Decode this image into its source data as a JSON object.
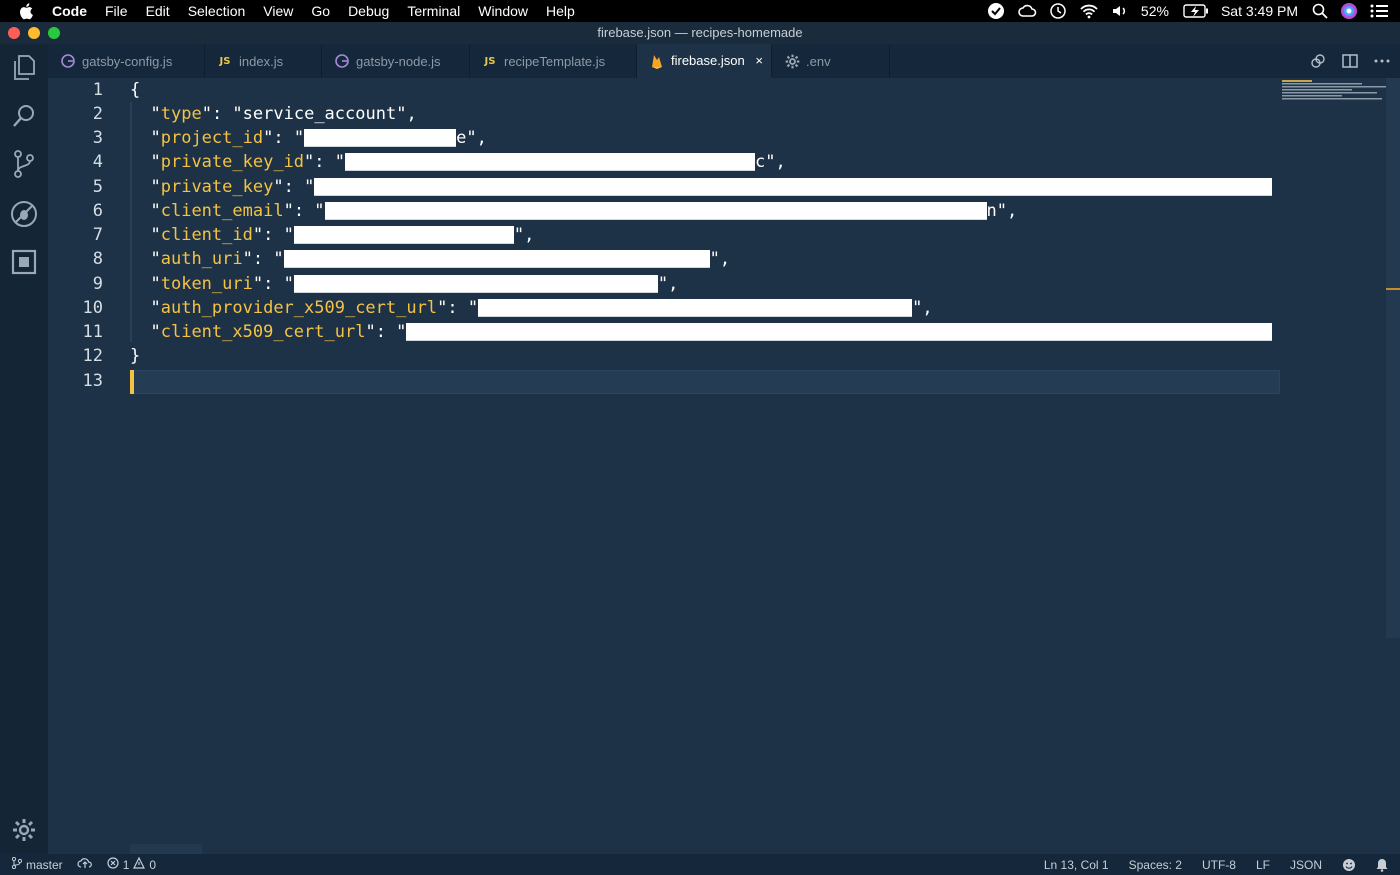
{
  "menubar": {
    "app_name": "Code",
    "items": [
      "File",
      "Edit",
      "Selection",
      "View",
      "Go",
      "Debug",
      "Terminal",
      "Window",
      "Help"
    ],
    "battery": "52%",
    "clock": "Sat 3:49 PM"
  },
  "window": {
    "title": "firebase.json — recipes-homemade"
  },
  "tabs": [
    {
      "label": "gatsby-config.js",
      "icon": "gatsby-icon"
    },
    {
      "label": "index.js",
      "icon": "js-icon",
      "badge": "JS"
    },
    {
      "label": "gatsby-node.js",
      "icon": "gatsby-icon"
    },
    {
      "label": "recipeTemplate.js",
      "icon": "js-icon",
      "badge": "JS"
    },
    {
      "label": "firebase.json",
      "icon": "firebase-icon",
      "active": true,
      "close": "×"
    },
    {
      "label": ".env",
      "icon": "gear-icon"
    }
  ],
  "editor": {
    "line_numbers": [
      "1",
      "2",
      "3",
      "4",
      "5",
      "6",
      "7",
      "8",
      "9",
      "10",
      "11",
      "12",
      "13"
    ],
    "lines": [
      {
        "text": "{"
      },
      {
        "key": "type",
        "value": "service_account",
        "redacted": false
      },
      {
        "key": "project_id",
        "redacted": true,
        "tail": "e"
      },
      {
        "key": "private_key_id",
        "redacted": true,
        "tail": "c"
      },
      {
        "key": "private_key",
        "redacted": true,
        "tail": ""
      },
      {
        "key": "client_email",
        "redacted": true,
        "tail": "n"
      },
      {
        "key": "client_id",
        "redacted": true,
        "tail": ""
      },
      {
        "key": "auth_uri",
        "redacted": true,
        "tail": ""
      },
      {
        "key": "token_uri",
        "redacted": true,
        "tail": ""
      },
      {
        "key": "auth_provider_x509_cert_url",
        "redacted": true,
        "tail": ""
      },
      {
        "key": "client_x509_cert_url",
        "redacted": true,
        "tail": ""
      },
      {
        "text": "}"
      },
      {
        "text": ""
      }
    ]
  },
  "statusbar": {
    "branch": "master",
    "errors": "1",
    "warnings": "0",
    "position": "Ln 13, Col 1",
    "spaces": "Spaces: 2",
    "encoding": "UTF-8",
    "eol": "LF",
    "language": "JSON"
  },
  "colors": {
    "background": "#1e3247",
    "key": "#f5c242",
    "accent_cursor": "#f5c242"
  }
}
